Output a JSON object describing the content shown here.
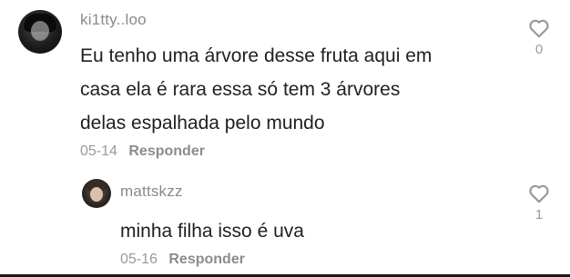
{
  "comments": [
    {
      "username": "ki1tty..loo",
      "text_lines": [
        "Eu tenho uma árvore desse fruta aqui em",
        "casa ela é rara essa só tem 3 árvores",
        "delas espalhada pelo mundo"
      ],
      "date": "05-14",
      "reply_label": "Responder",
      "like_count": "0",
      "like_icon": "heart-outline-icon"
    },
    {
      "username": "mattskzz",
      "text_lines": [
        "minha filha isso é uva"
      ],
      "date": "05-16",
      "reply_label": "Responder",
      "like_count": "1",
      "like_icon": "heart-outline-icon"
    }
  ]
}
